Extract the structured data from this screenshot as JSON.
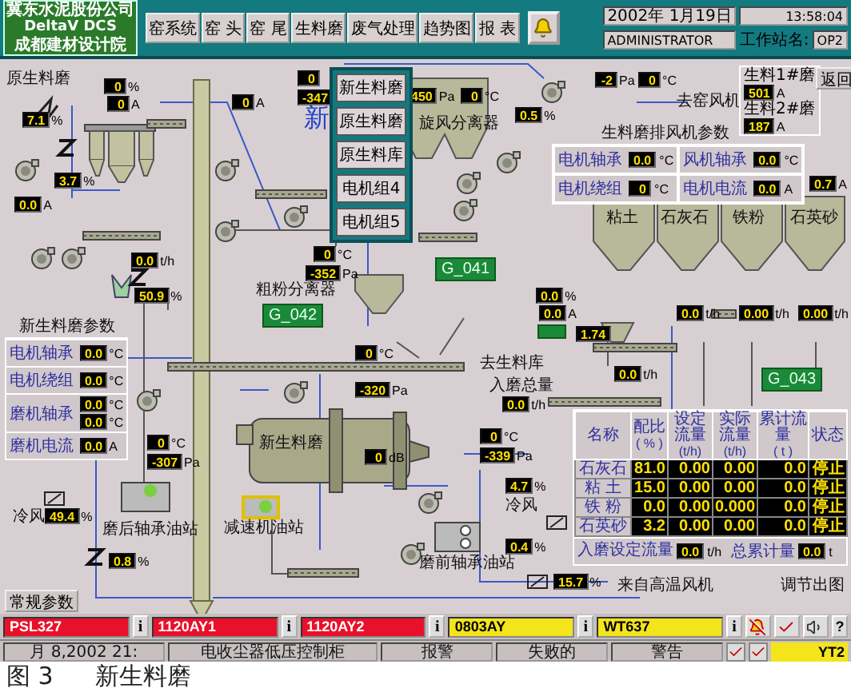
{
  "header": {
    "logo": [
      "冀东水泥股份公司",
      "DeltaV DCS",
      "成都建材设计院"
    ],
    "nav": [
      "窑系统",
      "窑 头",
      "窑 尾",
      "生料磨",
      "废气处理",
      "趋势图",
      "报 表"
    ],
    "date": "2002年 1月19日",
    "time": "13:58:04",
    "user": "ADMINISTRATOR",
    "station_label": "工作站名:",
    "station": "OP2"
  },
  "menu": {
    "big_char": "新",
    "items": [
      "新生料磨",
      "原生料磨",
      "原生料库",
      "电机组4",
      "电机组5"
    ]
  },
  "readouts": [
    {
      "value": "0",
      "unit": "%"
    },
    {
      "value": "0",
      "unit": "A"
    },
    {
      "value": "7.1",
      "unit": "%"
    },
    {
      "value": "0",
      "unit": "A"
    },
    {
      "value": "3.7",
      "unit": "%"
    },
    {
      "value": "0.0",
      "unit": "A"
    },
    {
      "value": "0.0",
      "unit": "t/h"
    },
    {
      "value": "50.9",
      "unit": "%"
    },
    {
      "value": "0"
    },
    {
      "value": "-347"
    },
    {
      "value": "450",
      "unit": "Pa"
    },
    {
      "value": "0",
      "unit": "°C"
    },
    {
      "value": "-2",
      "unit": "Pa"
    },
    {
      "value": "0",
      "unit": "°C"
    },
    {
      "value": "0.5",
      "unit": "%"
    },
    {
      "value": "0",
      "unit": "°C"
    },
    {
      "value": "-352",
      "unit": "Pa"
    },
    {
      "value": "0.7",
      "unit": "A"
    },
    {
      "value": "0.0",
      "unit": "%"
    },
    {
      "value": "0.0",
      "unit": "A"
    },
    {
      "value": "1.74"
    },
    {
      "value": "0.0",
      "unit": "t/h"
    },
    {
      "value": "0.00",
      "unit": "t/h"
    },
    {
      "value": "0.00",
      "unit": "t/h"
    },
    {
      "value": "0.0",
      "unit": "t/h"
    },
    {
      "value": "0.0",
      "unit": "t/h"
    },
    {
      "value": "0",
      "unit": "°C"
    },
    {
      "value": "-339",
      "unit": "Pa"
    },
    {
      "value": "4.7",
      "unit": "%"
    },
    {
      "value": "0.4",
      "unit": "%"
    },
    {
      "value": "15.7",
      "unit": "%"
    },
    {
      "value": "0",
      "unit": "°C"
    },
    {
      "value": "-320",
      "unit": "Pa"
    },
    {
      "value": "0",
      "unit": "°C"
    },
    {
      "value": "-307",
      "unit": "Pa"
    },
    {
      "value": "0",
      "unit": "dB"
    },
    {
      "value": "49.4",
      "unit": "%"
    },
    {
      "value": "0.8",
      "unit": "%"
    }
  ],
  "labels": [
    "原生料磨",
    "粗粉分离器",
    "旋风分离器",
    "去窑风机",
    "生料磨排风机参数",
    "去生料库",
    "入磨总量",
    "冷风",
    "来自高温风机",
    "磨前轴承油站",
    "调节出图",
    "新生料磨",
    "冷风",
    "磨后轴承油站",
    "减速机油站",
    "粘土",
    "石灰石",
    "铁粉",
    "石英砂"
  ],
  "tags": [
    "G_041",
    "G_042",
    "G_043"
  ],
  "mill_currents": [
    {
      "name": "生料1#磨",
      "value": "501",
      "unit": "A"
    },
    {
      "name": "生料2#磨",
      "value": "187",
      "unit": "A"
    }
  ],
  "back_button": "返回",
  "motor_table": {
    "title": "新生料磨参数",
    "rows": [
      {
        "name": "电机轴承",
        "values": [
          {
            "value": "0.0",
            "unit": "°C"
          }
        ]
      },
      {
        "name": "电机绕组",
        "values": [
          {
            "value": "0.0",
            "unit": "°C"
          }
        ]
      },
      {
        "name": "磨机轴承",
        "values": [
          {
            "value": "0.0",
            "unit": "°C"
          },
          {
            "value": "0.0",
            "unit": "°C"
          }
        ]
      },
      {
        "name": "磨机电流",
        "values": [
          {
            "value": "0.0",
            "unit": "A"
          }
        ]
      }
    ]
  },
  "fan_table": [
    {
      "name": "电机轴承",
      "value": "0.0",
      "unit": "°C"
    },
    {
      "name": "风机轴承",
      "value": "0.0",
      "unit": "°C"
    },
    {
      "name": "电机绕组",
      "value": "0",
      "unit": "°C"
    },
    {
      "name": "电机电流",
      "value": "0.0",
      "unit": "A"
    }
  ],
  "feed_table": {
    "columns": [
      {
        "name": "名称"
      },
      {
        "name": "配比",
        "unit": "( % )"
      },
      {
        "name": "设定流量",
        "unit": "(t/h)"
      },
      {
        "name": "实际流量",
        "unit": "(t/h)"
      },
      {
        "name": "累计流量",
        "unit": "( t )"
      },
      {
        "name": "状态"
      }
    ],
    "rows": [
      [
        "石灰石",
        "81.0",
        "0.00",
        "0.00",
        "0.0",
        "停止"
      ],
      [
        "粘 土",
        "15.0",
        "0.00",
        "0.00",
        "0.0",
        "停止"
      ],
      [
        "铁 粉",
        "0.0",
        "0.00",
        "0.000",
        "0.0",
        "停止"
      ],
      [
        "石英砂",
        "3.2",
        "0.00",
        "0.00",
        "0.0",
        "停止"
      ]
    ],
    "setpoint_label": "入磨设定流量",
    "setpoint": "0.0",
    "setpoint_unit": "t/h",
    "total_label": "总累计量",
    "total": "0.0",
    "total_unit": "t"
  },
  "params_button": "常规参数",
  "alarms": [
    {
      "tag": "PSL327",
      "color": "#e8102a",
      "info": "i"
    },
    {
      "tag": "1120AY1",
      "color": "#e8102a",
      "info": "i"
    },
    {
      "tag": "1120AY2",
      "color": "#e8102a",
      "info": "i"
    },
    {
      "tag": "0803AY",
      "color": "#f4e41c",
      "info": "i"
    },
    {
      "tag": "WT637",
      "color": "#f4e41c",
      "info": "i"
    }
  ],
  "help": "?",
  "status_bar": {
    "cells": [
      "月 8,2002 21:",
      "电收尘器低压控制柜",
      "报警",
      "失败的",
      "警告"
    ],
    "station": "YT2"
  },
  "caption": {
    "figure": "图 3",
    "title": "新生料磨"
  }
}
